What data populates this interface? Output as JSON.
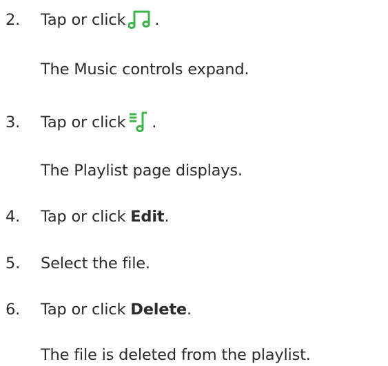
{
  "steps": [
    {
      "number": "2.",
      "text": "Tap or click",
      "icon": "music-note-icon",
      "suffix": ".",
      "note": "The Music controls expand."
    },
    {
      "number": "3.",
      "text": "Tap or click",
      "icon": "playlist-icon",
      "suffix": ".",
      "note": "The Playlist page displays."
    },
    {
      "number": "4.",
      "text": "Tap or click",
      "bold": "Edit",
      "suffix": "."
    },
    {
      "number": "5.",
      "text": "Select the file."
    },
    {
      "number": "6.",
      "text": "Tap or click",
      "bold": "Delete",
      "suffix": ".",
      "note": "The file is deleted from the playlist."
    }
  ],
  "colors": {
    "text": "#2b2b2b",
    "icon": "#3cb44a"
  }
}
